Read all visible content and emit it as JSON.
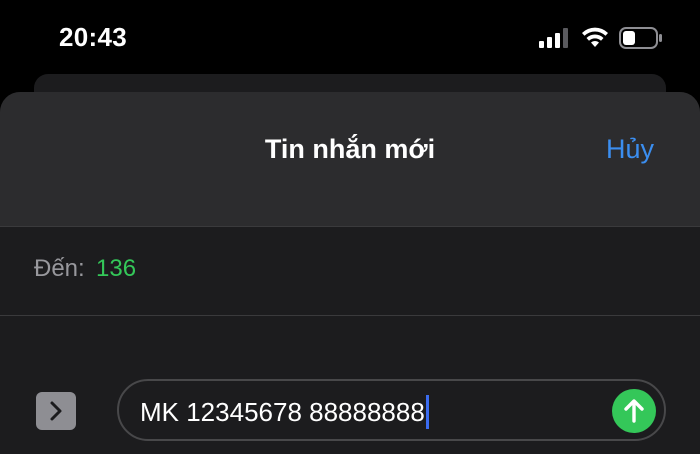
{
  "status_bar": {
    "time": "20:43",
    "icons": [
      "signal-icon",
      "wifi-icon",
      "battery-icon"
    ]
  },
  "header": {
    "title": "Tin nhắn mới",
    "cancel_label": "Hủy"
  },
  "recipient": {
    "label": "Đến:",
    "value": "136"
  },
  "composer": {
    "text": "MK 12345678 88888888",
    "expand_icon": "chevron-right-icon",
    "send_icon": "arrow-up-icon"
  },
  "colors": {
    "accent": "#3b8ef0",
    "recipient": "#34c759",
    "send": "#34c759",
    "background": "#000000",
    "sheet": "#1c1c1e",
    "nav": "#2c2c2e"
  }
}
